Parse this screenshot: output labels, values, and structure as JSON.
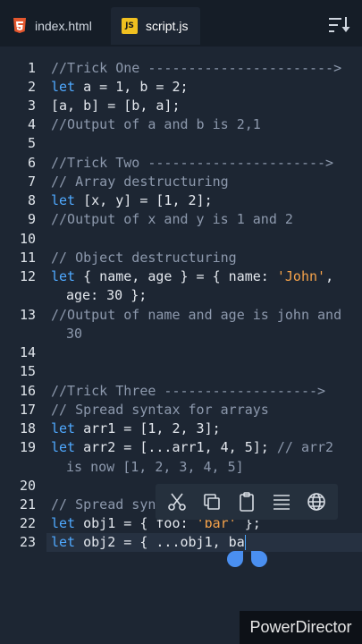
{
  "tabs": [
    {
      "label": "index.html",
      "icon": "html5-icon",
      "active": false
    },
    {
      "label": "script.js",
      "icon": "js-icon",
      "badge": "JS",
      "active": true
    }
  ],
  "sort_icon": "sort-icon",
  "editor": {
    "lines": {
      "l1": "//Trick One ----------------------->",
      "l2a": "let",
      "l2b": " a = 1, b = 2;",
      "l3": "[a, b] = [b, a];",
      "l4": "//Output of a and b is 2,1",
      "l6": "//Trick Two ---------------------->",
      "l7": "// Array destructuring",
      "l8a": "let",
      "l8b": " [x, y] = [1, 2];",
      "l9": "//Output of x and y is 1 and 2",
      "l11": "// Object destructuring",
      "l12a": "let",
      "l12b": " { name, age } = { name: ",
      "l12c": "'John'",
      "l12d": ",",
      "l12cont": "age: 30 };",
      "l13": "//Output of name and age is john and",
      "l13cont": "30",
      "l16": "//Trick Three ------------------->",
      "l17": "// Spread syntax for arrays",
      "l18a": "let",
      "l18b": " arr1 = [1, 2, 3];",
      "l19a": "let",
      "l19b": " arr2 = [...arr1, 4, 5]; ",
      "l19c": "// arr2",
      "l19cont": "is now [1, 2, 3, 4, 5]",
      "l21": "// Spread syn",
      "l22a": "let",
      "l22b": " obj1 = { foo: ",
      "l22c": "'bar'",
      "l22d": " };",
      "l23a": "let",
      "l23b": " obj2 = { ...obj1, ba"
    },
    "line_numbers": [
      "1",
      "2",
      "3",
      "4",
      "5",
      "6",
      "7",
      "8",
      "9",
      "10",
      "11",
      "12",
      "13",
      "14",
      "15",
      "16",
      "17",
      "18",
      "19",
      "20",
      "21",
      "22",
      "23"
    ]
  },
  "selection_toolbar": [
    "cut-icon",
    "copy-icon",
    "paste-icon",
    "select-all-icon",
    "web-search-icon"
  ],
  "watermark": "PowerDirector",
  "colors": {
    "keyword": "#4fa9ff",
    "comment": "#8d99ad",
    "string": "#f5a24a",
    "background": "#1d2633"
  }
}
